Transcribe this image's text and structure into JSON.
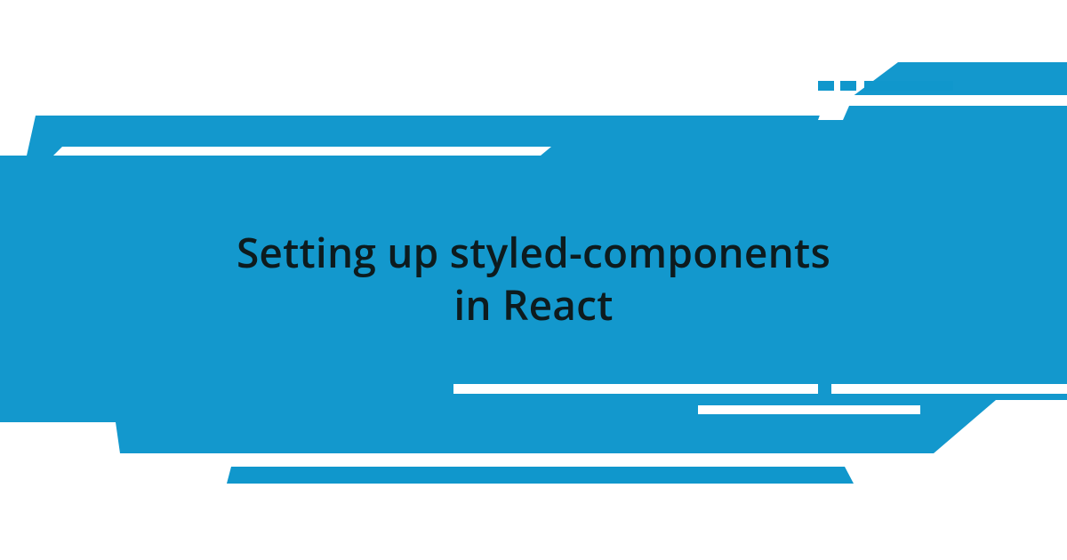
{
  "colors": {
    "accent": "#1398cd",
    "accent_alt": "#1097cc",
    "text": "#0d1b1e",
    "background": "#ffffff"
  },
  "title": "Setting up styled-components\nin React"
}
